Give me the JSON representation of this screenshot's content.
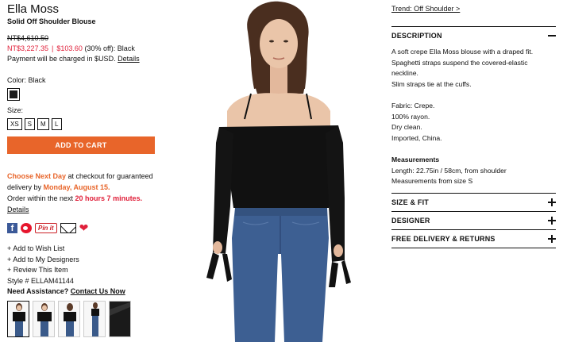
{
  "product": {
    "brand": "Ella Moss",
    "name": "Solid Off Shoulder Blouse",
    "old_price": "NT$4,610.50",
    "new_price": "NT$3,227.35",
    "sale_price": "$103.60",
    "promo_suffix": "(30% off): Black",
    "payment_note": "Payment will be charged in $USD.",
    "details_link": "Details"
  },
  "options": {
    "color_label": "Color: Black",
    "swatch_color": "#1a1a1a",
    "size_label": "Size:",
    "sizes": [
      "XS",
      "S",
      "M",
      "L"
    ]
  },
  "cart": {
    "label": "ADD TO CART",
    "color": "#e8652a"
  },
  "delivery": {
    "choose": "Choose Next Day",
    "text1": " at checkout for guaranteed delivery by ",
    "date": "Monday, August 15.",
    "text2": "Order within the next ",
    "time": "20 hours 7 minutes.",
    "details_link": "Details"
  },
  "social": {
    "facebook": "f",
    "pinterest": "Pin it",
    "icons": [
      "facebook-icon",
      "weibo-icon",
      "pinterest-icon",
      "email-icon",
      "heart-icon"
    ]
  },
  "actions": {
    "wishlist": "+ Add to Wish List",
    "designers": "+ Add to My Designers",
    "review": "+ Review This Item",
    "style": "Style # ELLAM41144",
    "assist_label": "Need Assistance?",
    "contact_link": "Contact Us Now"
  },
  "right": {
    "trend_link": "Trend: Off Shoulder >",
    "description_title": "DESCRIPTION",
    "description_lines": [
      "A soft crepe Ella Moss blouse with a draped fit.",
      "Spaghetti straps suspend the covered-elastic neckline.",
      "Slim straps tie at the cuffs."
    ],
    "fabric_lines": [
      "Fabric: Crepe.",
      "100% rayon.",
      "Dry clean.",
      "Imported, China."
    ],
    "measurements_title": "Measurements",
    "measurement_lines": [
      "Length: 22.75in / 58cm, from shoulder",
      "Measurements from size S"
    ],
    "sections": [
      "SIZE & FIT",
      "DESIGNER",
      "FREE DELIVERY & RETURNS"
    ]
  },
  "colors": {
    "accent_orange": "#e8652a",
    "sale_red": "#e0203a"
  }
}
